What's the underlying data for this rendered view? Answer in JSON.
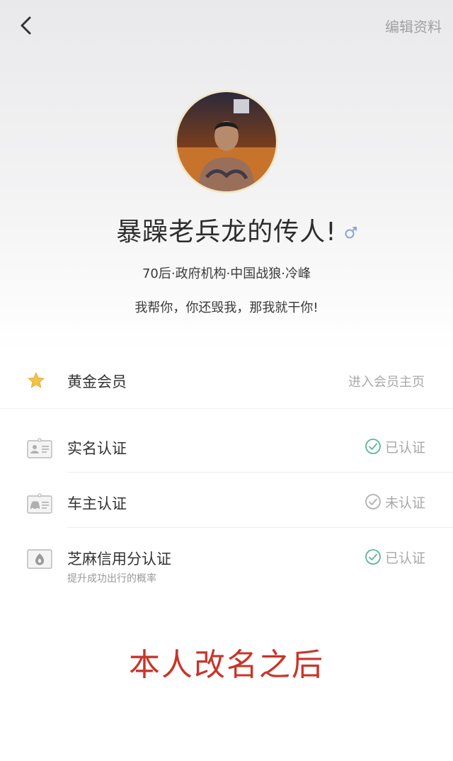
{
  "header": {
    "edit_label": "编辑资料"
  },
  "profile": {
    "nickname": "暴躁老兵龙的传人!",
    "gender_icon": "male-icon",
    "meta": "70后·政府机构·中国战狼·冷峰",
    "signature": "我帮你，你还毁我，那我就干你!"
  },
  "membership": {
    "label": "黄金会员",
    "action": "进入会员主页",
    "icon": "star-icon"
  },
  "verifications": [
    {
      "label": "实名认证",
      "status": "已认证",
      "icon": "id-card-icon"
    },
    {
      "label": "车主认证",
      "status": "未认证",
      "icon": "car-card-icon"
    },
    {
      "label": "芝麻信用分认证",
      "status": "已认证",
      "sublabel": "提升成功出行的概率",
      "icon": "sesame-credit-icon"
    }
  ],
  "caption": "本人改名之后",
  "colors": {
    "verified": "#5db59a",
    "unverified": "#b0b0b0",
    "caption": "#c8352a",
    "gender": "#8aa6d8",
    "star": "#f3c24a"
  }
}
